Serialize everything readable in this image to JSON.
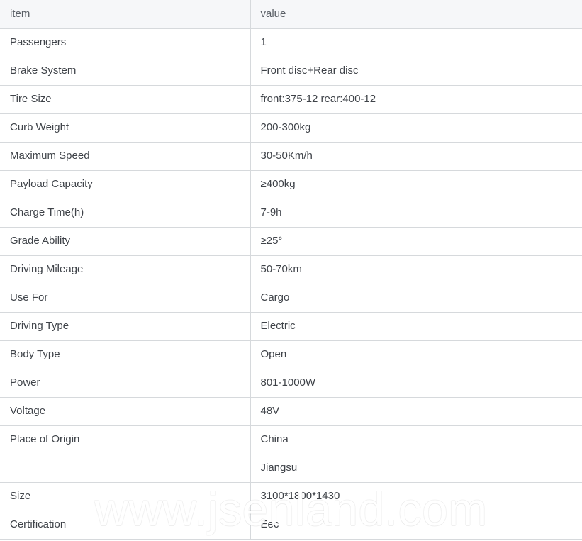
{
  "table": {
    "headers": {
      "item": "item",
      "value": "value"
    },
    "rows": [
      {
        "item": "Passengers",
        "value": "1"
      },
      {
        "item": "Brake System",
        "value": "Front disc+Rear disc"
      },
      {
        "item": "Tire Size",
        "value": "front:375-12 rear:400-12"
      },
      {
        "item": "Curb Weight",
        "value": "200-300kg"
      },
      {
        "item": "Maximum Speed",
        "value": "30-50Km/h"
      },
      {
        "item": "Payload Capacity",
        "value": "≥400kg"
      },
      {
        "item": "Charge Time(h)",
        "value": "7-9h"
      },
      {
        "item": "Grade Ability",
        "value": "≥25°"
      },
      {
        "item": "Driving Mileage",
        "value": "50-70km"
      },
      {
        "item": "Use For",
        "value": "Cargo"
      },
      {
        "item": "Driving Type",
        "value": "Electric"
      },
      {
        "item": "Body Type",
        "value": "Open"
      },
      {
        "item": "Power",
        "value": "801-1000W"
      },
      {
        "item": "Voltage",
        "value": "48V"
      },
      {
        "item": "Place of Origin",
        "value": "China"
      },
      {
        "item": "",
        "value": "Jiangsu"
      },
      {
        "item": "Size",
        "value": "3100*1800*1430"
      },
      {
        "item": "Certification",
        "value": "Eec"
      }
    ]
  },
  "watermark": {
    "text": "www.jsenland.com"
  },
  "colors": {
    "header_background": "#f6f7f9",
    "row_background": "#ffffff",
    "border": "#d6d9dc",
    "text": "#3f4349",
    "header_text": "#5a5f66",
    "watermark": "#ffffff"
  }
}
